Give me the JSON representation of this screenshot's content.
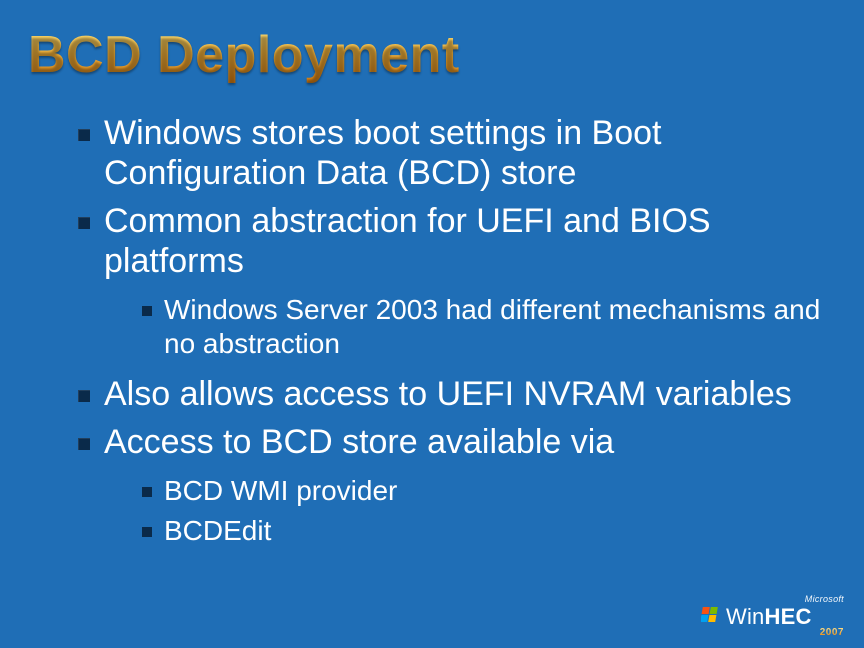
{
  "title": "BCD Deployment",
  "bullets": {
    "b1": "Windows stores boot settings in Boot Configuration Data (BCD) store",
    "b2": "Common abstraction for UEFI and BIOS platforms",
    "b2_sub1": "Windows Server 2003 had different mechanisms and no abstraction",
    "b3": "Also allows access to UEFI NVRAM variables",
    "b4": "Access to BCD store available via",
    "b4_sub1": "BCD WMI provider",
    "b4_sub2": "BCDEdit"
  },
  "footer": {
    "company": "Microsoft",
    "brand_thin": "Win",
    "brand_bold": "HEC",
    "year": "2007"
  }
}
